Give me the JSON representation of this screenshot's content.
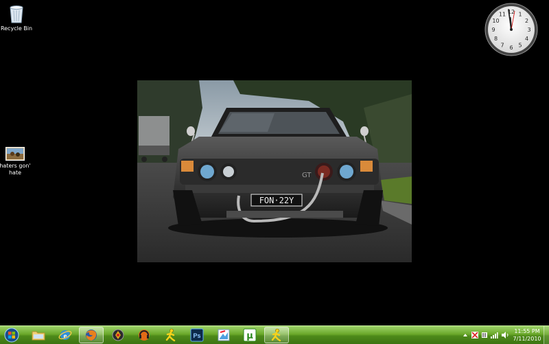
{
  "desktop": {
    "icons": [
      {
        "label": "Recycle Bin"
      },
      {
        "label": "haters gon' hate"
      }
    ]
  },
  "wallpaper": {
    "license_plate": "FON·22Y",
    "badge": "GT"
  },
  "clock_gadget": {
    "numbers": [
      "12",
      "1",
      "2",
      "3",
      "4",
      "5",
      "6",
      "7",
      "8",
      "9",
      "10",
      "11"
    ]
  },
  "taskbar": {
    "pinned": [
      {
        "icon": "folder-icon"
      },
      {
        "icon": "internet-explorer-icon"
      },
      {
        "icon": "firefox-icon"
      },
      {
        "icon": "winamp-icon"
      },
      {
        "icon": "music-player-icon"
      },
      {
        "icon": "aim-icon"
      },
      {
        "icon": "photoshop-icon"
      },
      {
        "icon": "paint-icon"
      },
      {
        "icon": "utorrent-icon"
      },
      {
        "icon": "aim-icon"
      }
    ],
    "photoshop_label": "Ps",
    "utorrent_label": "µ",
    "tray": {
      "time": "11:55 PM",
      "date": "7/11/2010"
    }
  },
  "colors": {
    "taskbar_green": "#5a9a22",
    "desktop_background": "#000000"
  }
}
